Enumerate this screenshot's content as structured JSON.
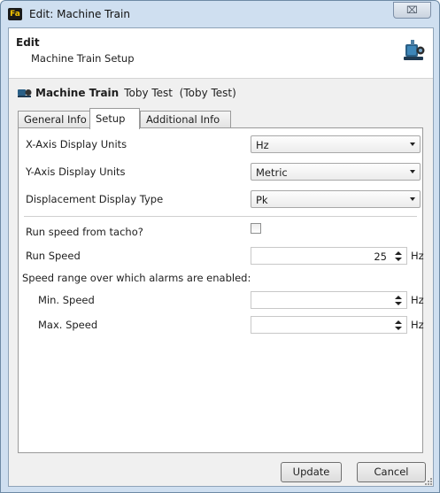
{
  "window": {
    "title": "Edit: Machine Train",
    "app_icon_text": "Fa",
    "close_glyph": "⌧"
  },
  "header": {
    "heading": "Edit",
    "subheading": "Machine Train Setup",
    "icon": "machine-train-icon"
  },
  "machine_train": {
    "label": "Machine Train",
    "name": "Toby Test",
    "detail": "(Toby Test)",
    "icon": "machine-train-icon"
  },
  "tabs": [
    {
      "label": "General Info",
      "active": false
    },
    {
      "label": "Setup",
      "active": true
    },
    {
      "label": "Additional Info",
      "active": false
    }
  ],
  "setup": {
    "x_axis": {
      "label": "X-Axis Display Units",
      "value": "Hz"
    },
    "y_axis": {
      "label": "Y-Axis Display Units",
      "value": "Metric"
    },
    "displacement": {
      "label": "Displacement Display Type",
      "value": "Pk"
    },
    "run_speed_tacho": {
      "label": "Run speed from tacho?",
      "checked": false
    },
    "run_speed": {
      "label": "Run Speed",
      "value": "25",
      "unit": "Hz"
    },
    "alarm_range_label": "Speed range over which alarms are enabled:",
    "min_speed": {
      "label": "Min. Speed",
      "value": "",
      "unit": "Hz"
    },
    "max_speed": {
      "label": "Max. Speed",
      "value": "",
      "unit": "Hz"
    }
  },
  "footer": {
    "update_label": "Update",
    "cancel_label": "Cancel"
  },
  "colors": {
    "window_frame": "#cfdff0",
    "client_bg": "#f0f0f0",
    "panel_bg": "#ffffff",
    "app_icon_bg": "#1a1a1a",
    "app_icon_fg": "#f5c400"
  }
}
